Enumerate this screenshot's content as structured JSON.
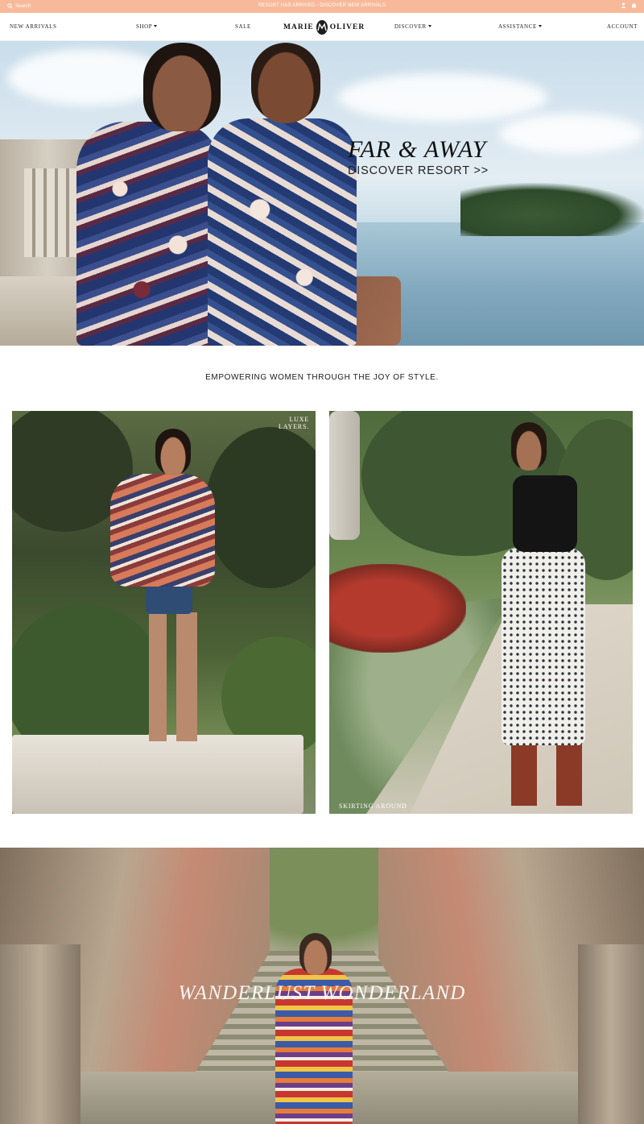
{
  "topbar": {
    "search_label": "Search",
    "announcement": "RESORT HAS ARRIVED - DISCOVER NEW ARRIVALS",
    "background": "#f8b99a",
    "icons": [
      "user-icon",
      "bag-icon"
    ]
  },
  "nav": {
    "new_arrivals": "NEW ARRIVALS",
    "shop": "SHOP",
    "sale": "SALE",
    "logo_left": "MARIE",
    "logo_right": "OLIVER",
    "discover": "DISCOVER",
    "assistance": "ASSISTANCE",
    "account": "ACCOUNT"
  },
  "hero": {
    "title": "FAR & AWAY",
    "link": "DISCOVER RESORT >>"
  },
  "tagline": "EMPOWERING WOMEN THROUGH THE JOY OF STYLE.",
  "tiles": [
    {
      "caption_line1": "LUXE",
      "caption_line2": "LAYERS."
    },
    {
      "caption": "SKIRTING AROUND"
    }
  ],
  "banner": {
    "title": "WANDERLUST WONDERLAND"
  }
}
